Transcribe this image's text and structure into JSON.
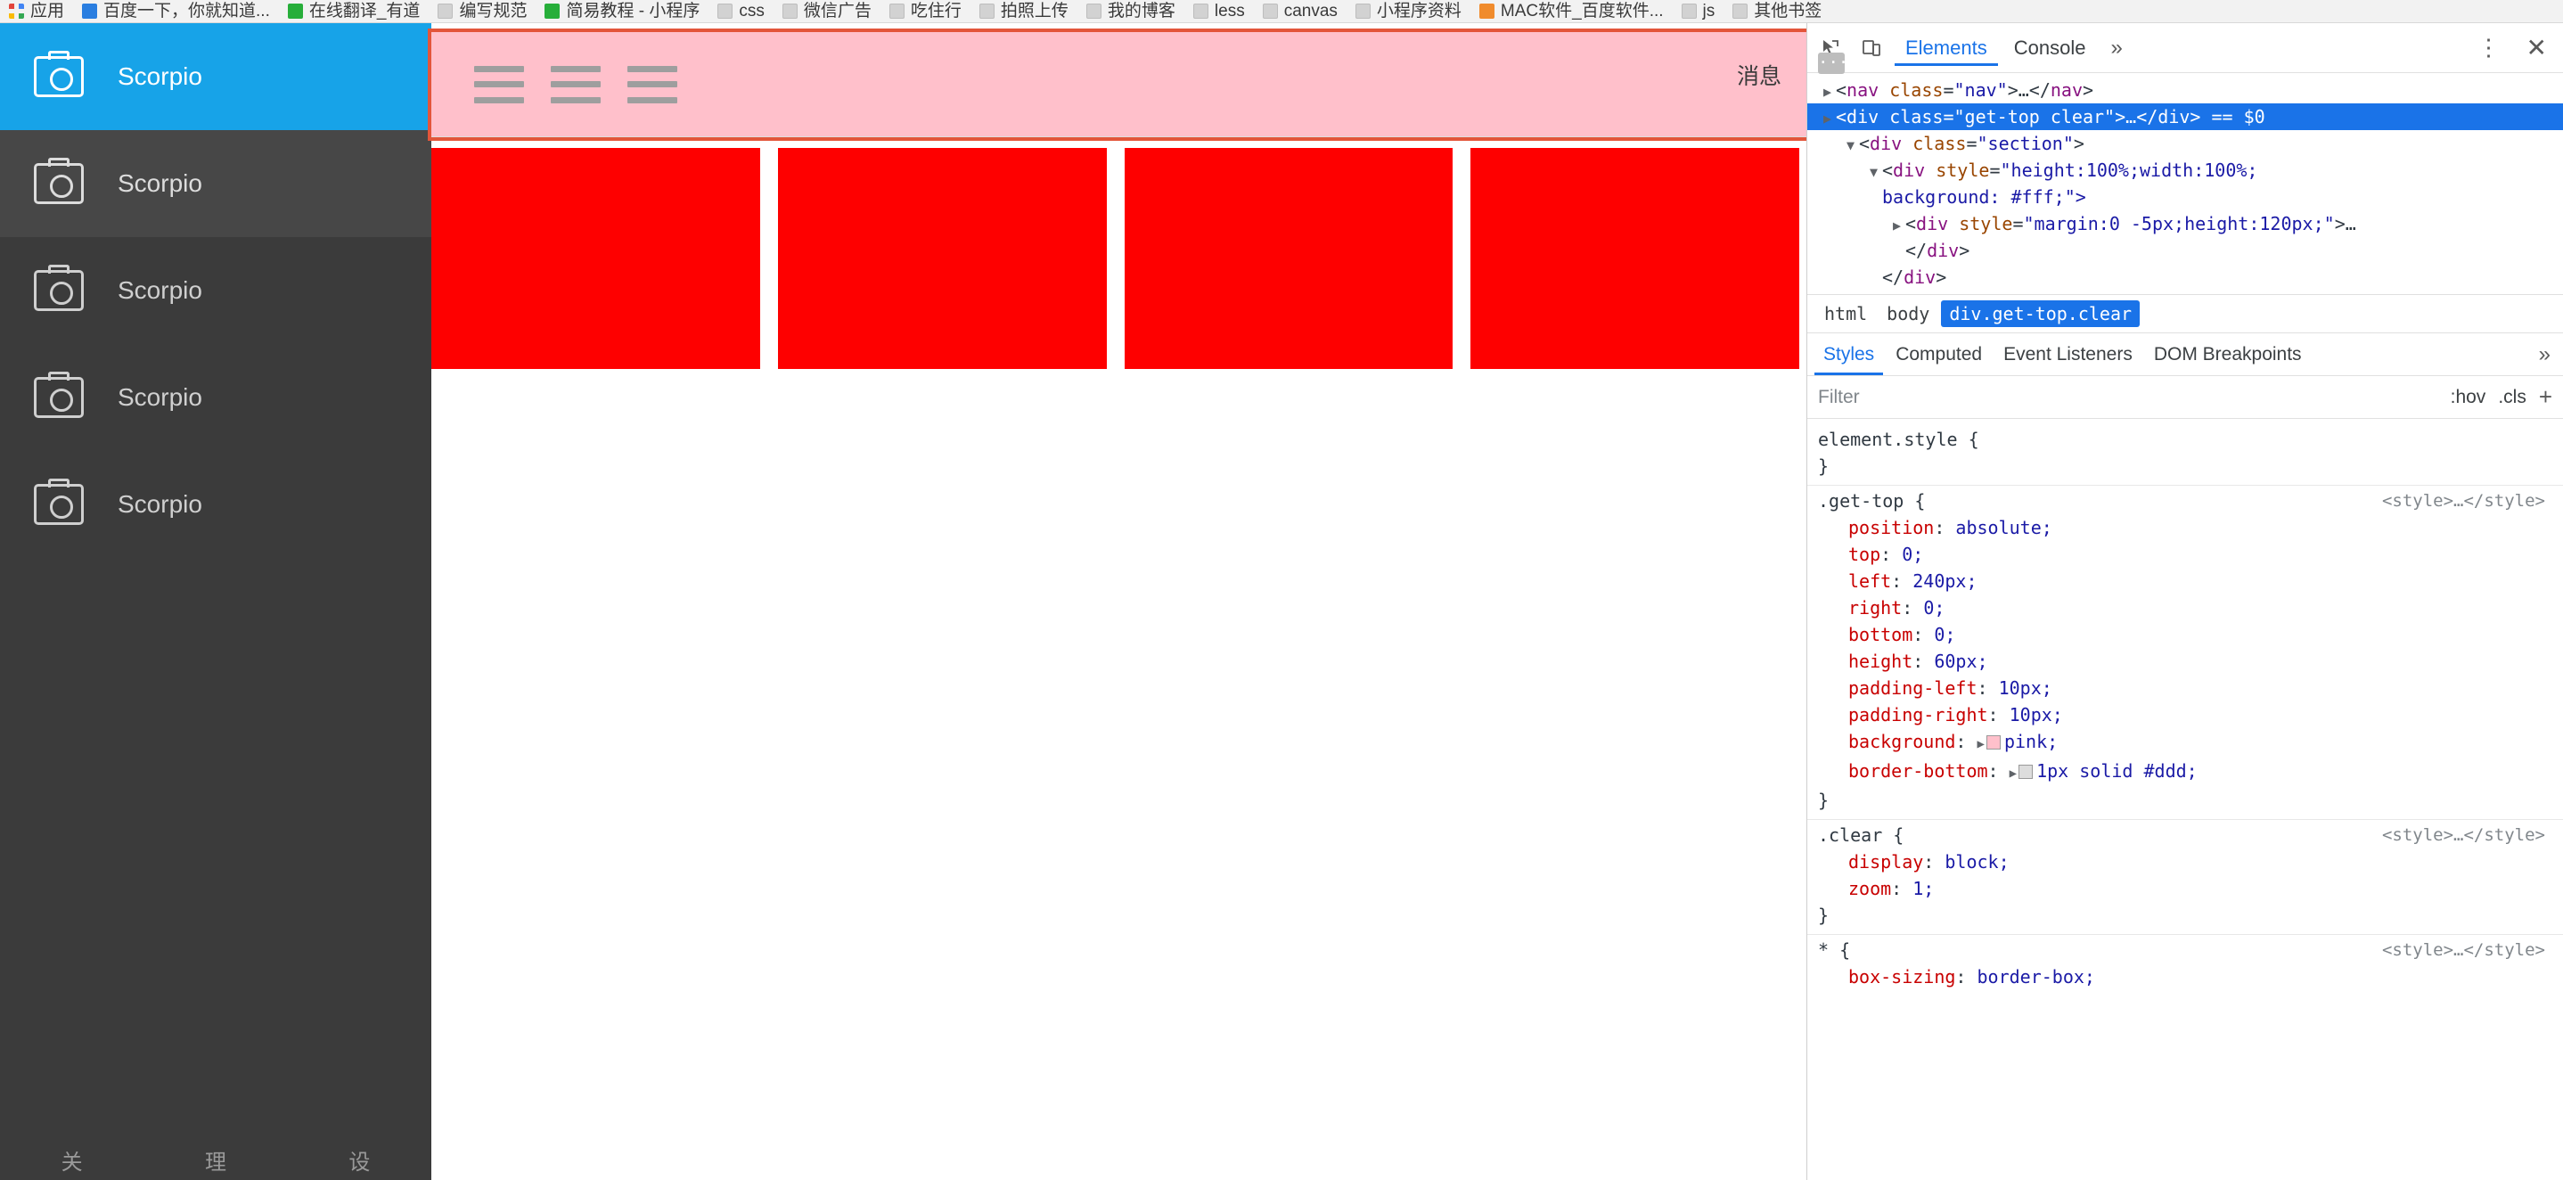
{
  "bookmarks": [
    {
      "label": "应用",
      "icon": "apps-grid-icon",
      "style": "grid"
    },
    {
      "label": "百度一下，你就知道...",
      "icon": "baidu-icon",
      "style": "blue"
    },
    {
      "label": "在线翻译_有道",
      "icon": "youdao-icon",
      "style": "green"
    },
    {
      "label": "编写规范",
      "icon": "folder-icon",
      "style": "gray"
    },
    {
      "label": "简易教程 - 小程序",
      "icon": "green-dot-icon",
      "style": "green"
    },
    {
      "label": "css",
      "icon": "folder-icon",
      "style": "gray"
    },
    {
      "label": "微信广告",
      "icon": "folder-icon",
      "style": "gray"
    },
    {
      "label": "吃住行",
      "icon": "folder-icon",
      "style": "gray"
    },
    {
      "label": "拍照上传",
      "icon": "folder-icon",
      "style": "gray"
    },
    {
      "label": "我的博客",
      "icon": "folder-icon",
      "style": "gray"
    },
    {
      "label": "less",
      "icon": "folder-icon",
      "style": "gray"
    },
    {
      "label": "canvas",
      "icon": "folder-icon",
      "style": "gray"
    },
    {
      "label": "小程序资料",
      "icon": "folder-icon",
      "style": "gray"
    },
    {
      "label": "MAC软件_百度软件...",
      "icon": "mac-icon",
      "style": "orange"
    },
    {
      "label": "js",
      "icon": "folder-icon",
      "style": "gray"
    },
    {
      "label": "其他书签",
      "icon": "folder-icon",
      "style": "gray"
    }
  ],
  "page": {
    "sidebar": {
      "items": [
        {
          "label": "Scorpio",
          "active": true
        },
        {
          "label": "Scorpio",
          "active": false
        },
        {
          "label": "Scorpio",
          "active": false
        },
        {
          "label": "Scorpio",
          "active": false
        },
        {
          "label": "Scorpio",
          "active": false
        }
      ],
      "bottom_tabs": [
        "关",
        "理",
        "设"
      ]
    },
    "get_top": {
      "message_label": "消息",
      "background_color": "#ffc0cb",
      "highlight_color": "#e3553a",
      "hamburger_count": 3
    },
    "red_boxes": {
      "count": 4,
      "color": "#fe0000"
    }
  },
  "devtools": {
    "toolbar": {
      "inspect_icon": "inspect-cursor-icon",
      "device_icon": "device-toolbar-icon",
      "tabs": [
        {
          "label": "Elements",
          "selected": true
        },
        {
          "label": "Console",
          "selected": false
        }
      ],
      "more_tabs_icon": "chevron-double-right-icon",
      "settings_icon": "kebab-menu-icon",
      "close_icon": "close-icon"
    },
    "dom": [
      {
        "indent": 0,
        "triangle": "▶",
        "parts": [
          {
            "t": "punct",
            "v": "<"
          },
          {
            "t": "tag",
            "v": "nav"
          },
          {
            "t": "space",
            "v": " "
          },
          {
            "t": "attr",
            "v": "class"
          },
          {
            "t": "punct",
            "v": "="
          },
          {
            "t": "val",
            "v": "\"nav\""
          },
          {
            "t": "punct",
            "v": ">…</"
          },
          {
            "t": "tag",
            "v": "nav"
          },
          {
            "t": "punct",
            "v": ">"
          }
        ],
        "selected": false
      },
      {
        "indent": 0,
        "triangle": "▶",
        "parts": [
          {
            "t": "punct",
            "v": "<"
          },
          {
            "t": "tag",
            "v": "div"
          },
          {
            "t": "space",
            "v": " "
          },
          {
            "t": "attr",
            "v": "class"
          },
          {
            "t": "punct",
            "v": "="
          },
          {
            "t": "val",
            "v": "\"get-top clear\""
          },
          {
            "t": "punct",
            "v": ">…</"
          },
          {
            "t": "tag",
            "v": "div"
          },
          {
            "t": "punct",
            "v": ">"
          },
          {
            "t": "space",
            "v": "  "
          },
          {
            "t": "dollar",
            "v": "== $0"
          }
        ],
        "selected": true
      },
      {
        "indent": 1,
        "triangle": "▼",
        "parts": [
          {
            "t": "punct",
            "v": "<"
          },
          {
            "t": "tag",
            "v": "div"
          },
          {
            "t": "space",
            "v": " "
          },
          {
            "t": "attr",
            "v": "class"
          },
          {
            "t": "punct",
            "v": "="
          },
          {
            "t": "val",
            "v": "\"section\""
          },
          {
            "t": "punct",
            "v": ">"
          }
        ],
        "selected": false
      },
      {
        "indent": 2,
        "triangle": "▼",
        "parts": [
          {
            "t": "punct",
            "v": "<"
          },
          {
            "t": "tag",
            "v": "div"
          },
          {
            "t": "space",
            "v": " "
          },
          {
            "t": "attr",
            "v": "style"
          },
          {
            "t": "punct",
            "v": "="
          },
          {
            "t": "val",
            "v": "\"height:100%;width:100%;"
          }
        ],
        "selected": false
      },
      {
        "indent": 2,
        "triangle": "",
        "parts": [
          {
            "t": "val",
            "v": "background: #fff;\">"
          }
        ],
        "selected": false
      },
      {
        "indent": 3,
        "triangle": "▶",
        "parts": [
          {
            "t": "punct",
            "v": "<"
          },
          {
            "t": "tag",
            "v": "div"
          },
          {
            "t": "space",
            "v": " "
          },
          {
            "t": "attr",
            "v": "style"
          },
          {
            "t": "punct",
            "v": "="
          },
          {
            "t": "val",
            "v": "\"margin:0 -5px;height:120px;\""
          },
          {
            "t": "punct",
            "v": ">…"
          }
        ],
        "selected": false
      },
      {
        "indent": 3,
        "triangle": "",
        "parts": [
          {
            "t": "punct",
            "v": "</"
          },
          {
            "t": "tag",
            "v": "div"
          },
          {
            "t": "punct",
            "v": ">"
          }
        ],
        "selected": false
      },
      {
        "indent": 2,
        "triangle": "",
        "parts": [
          {
            "t": "punct",
            "v": "</"
          },
          {
            "t": "tag",
            "v": "div"
          },
          {
            "t": "punct",
            "v": ">"
          }
        ],
        "selected": false
      }
    ],
    "breadcrumb": [
      {
        "label": "html",
        "selected": false
      },
      {
        "label": "body",
        "selected": false
      },
      {
        "label": "div.get-top.clear",
        "selected": true
      }
    ],
    "styles_tabs": [
      {
        "label": "Styles",
        "selected": true
      },
      {
        "label": "Computed",
        "selected": false
      },
      {
        "label": "Event Listeners",
        "selected": false
      },
      {
        "label": "DOM Breakpoints",
        "selected": false
      }
    ],
    "styles_more_icon": "chevron-double-right-icon",
    "filter": {
      "placeholder": "Filter",
      "hov": ":hov",
      "cls": ".cls",
      "plus": "+"
    },
    "rules": [
      {
        "selector": "element.style {",
        "source": "",
        "props": [],
        "close": "}"
      },
      {
        "selector": ".get-top {",
        "source": "<style>…</style>",
        "props": [
          {
            "name": "position",
            "value": "absolute;",
            "swatch": "",
            "tri": false
          },
          {
            "name": "top",
            "value": "0;",
            "swatch": "",
            "tri": false
          },
          {
            "name": "left",
            "value": "240px;",
            "swatch": "",
            "tri": false
          },
          {
            "name": "right",
            "value": "0;",
            "swatch": "",
            "tri": false
          },
          {
            "name": "bottom",
            "value": "0;",
            "swatch": "",
            "tri": false
          },
          {
            "name": "height",
            "value": "60px;",
            "swatch": "",
            "tri": false
          },
          {
            "name": "padding-left",
            "value": "10px;",
            "swatch": "",
            "tri": false
          },
          {
            "name": "padding-right",
            "value": "10px;",
            "swatch": "",
            "tri": false
          },
          {
            "name": "background",
            "value": "pink;",
            "swatch": "pink",
            "tri": true
          },
          {
            "name": "border-bottom",
            "value": "1px solid #ddd;",
            "swatch": "ddd",
            "tri": true
          }
        ],
        "close": "}"
      },
      {
        "selector": ".clear {",
        "source": "<style>…</style>",
        "props": [
          {
            "name": "display",
            "value": "block;",
            "swatch": "",
            "tri": false
          },
          {
            "name": "zoom",
            "value": "1;",
            "swatch": "",
            "tri": false
          }
        ],
        "close": "}"
      },
      {
        "selector": "* {",
        "source": "<style>…</style>",
        "props": [
          {
            "name": "box-sizing",
            "value": "border-box;",
            "swatch": "",
            "tri": false
          }
        ],
        "close": ""
      }
    ]
  }
}
